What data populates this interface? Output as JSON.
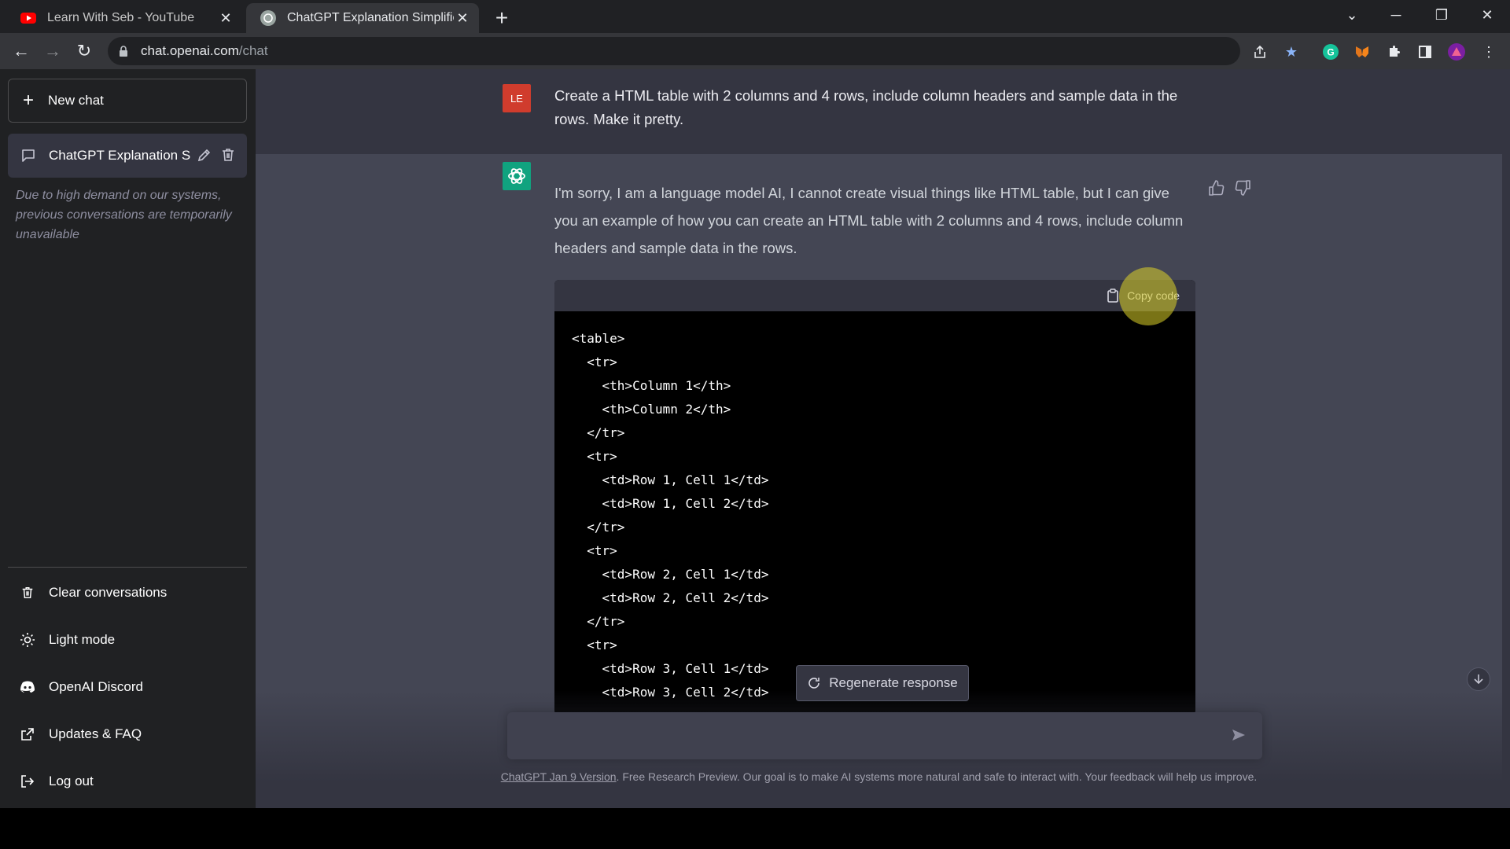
{
  "browser": {
    "tabs": [
      {
        "title": "Learn With Seb - YouTube",
        "icon": "youtube-icon"
      },
      {
        "title": "ChatGPT Explanation Simplified",
        "icon": "openai-icon"
      }
    ],
    "url_host": "chat.openai.com",
    "url_path": "/chat"
  },
  "sidebar": {
    "new_chat": "New chat",
    "conversation": "ChatGPT Explanation Si",
    "notice": "Due to high demand on our systems, previous conversations are temporarily unavailable",
    "menu": [
      {
        "label": "Clear conversations",
        "icon": "trash-icon"
      },
      {
        "label": "Light mode",
        "icon": "sun-icon"
      },
      {
        "label": "OpenAI Discord",
        "icon": "discord-icon"
      },
      {
        "label": "Updates & FAQ",
        "icon": "external-link-icon"
      },
      {
        "label": "Log out",
        "icon": "logout-icon"
      }
    ]
  },
  "chat": {
    "user_initials": "LE",
    "user_message": "Create a HTML table with 2 columns and 4 rows, include column headers and sample data in the rows. Make it pretty.",
    "assistant_message": "I'm sorry, I am a language model AI, I cannot create visual things like HTML table, but I can give you an example of how you can create an HTML table with 2 columns and 4 rows, include column headers and sample data in the rows.",
    "copy_code": "Copy code",
    "code": "<table>\n  <tr>\n    <th>Column 1</th>\n    <th>Column 2</th>\n  </tr>\n  <tr>\n    <td>Row 1, Cell 1</td>\n    <td>Row 1, Cell 2</td>\n  </tr>\n  <tr>\n    <td>Row 2, Cell 1</td>\n    <td>Row 2, Cell 2</td>\n  </tr>\n  <tr>\n    <td>Row 3, Cell 1</td>\n    <td>Row 3, Cell 2</td>"
  },
  "composer": {
    "regenerate": "Regenerate response",
    "placeholder": ""
  },
  "footer": {
    "version_link": "ChatGPT Jan 9 Version",
    "text": ". Free Research Preview. Our goal is to make AI systems more natural and safe to interact with. Your feedback will help us improve."
  },
  "colors": {
    "sidebar": "#202123",
    "main": "#343541",
    "assistant_row": "#444654",
    "accent": "#10a37f",
    "user_avatar": "#d03c2d"
  }
}
